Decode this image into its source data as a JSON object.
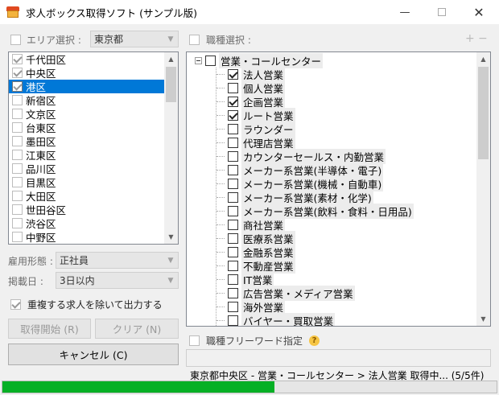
{
  "window": {
    "title": "求人ボックス取得ソフト (サンプル版)",
    "minimize": "—",
    "close": "✕"
  },
  "area": {
    "label": "エリア選択 :",
    "selected": "東京都",
    "items": [
      {
        "label": "千代田区",
        "checked": true,
        "selected": false
      },
      {
        "label": "中央区",
        "checked": true,
        "selected": false
      },
      {
        "label": "港区",
        "checked": true,
        "selected": true
      },
      {
        "label": "新宿区",
        "checked": false,
        "selected": false
      },
      {
        "label": "文京区",
        "checked": false,
        "selected": false
      },
      {
        "label": "台東区",
        "checked": false,
        "selected": false
      },
      {
        "label": "墨田区",
        "checked": false,
        "selected": false
      },
      {
        "label": "江東区",
        "checked": false,
        "selected": false
      },
      {
        "label": "品川区",
        "checked": false,
        "selected": false
      },
      {
        "label": "目黒区",
        "checked": false,
        "selected": false
      },
      {
        "label": "大田区",
        "checked": false,
        "selected": false
      },
      {
        "label": "世田谷区",
        "checked": false,
        "selected": false
      },
      {
        "label": "渋谷区",
        "checked": false,
        "selected": false
      },
      {
        "label": "中野区",
        "checked": false,
        "selected": false
      }
    ]
  },
  "employment": {
    "label": "雇用形態 :",
    "value": "正社員"
  },
  "posted": {
    "label": "掲載日 :",
    "value": "3日以内"
  },
  "dedupe": {
    "label": "重複する求人を除いて出力する",
    "checked": true
  },
  "buttons": {
    "start": "取得開始 (R)",
    "clear": "クリア (N)",
    "cancel": "キャンセル (C)"
  },
  "job": {
    "label": "職種選択 :",
    "plus": "+",
    "minus": "−",
    "root": "営業・コールセンター",
    "items": [
      {
        "label": "法人営業",
        "checked": true
      },
      {
        "label": "個人営業",
        "checked": false
      },
      {
        "label": "企画営業",
        "checked": true
      },
      {
        "label": "ルート営業",
        "checked": true
      },
      {
        "label": "ラウンダー",
        "checked": false
      },
      {
        "label": "代理店営業",
        "checked": false
      },
      {
        "label": "カウンターセールス・内勤営業",
        "checked": false
      },
      {
        "label": "メーカー系営業(半導体・電子)",
        "checked": false
      },
      {
        "label": "メーカー系営業(機械・自動車)",
        "checked": false
      },
      {
        "label": "メーカー系営業(素材・化学)",
        "checked": false
      },
      {
        "label": "メーカー系営業(飲料・食料・日用品)",
        "checked": false
      },
      {
        "label": "商社営業",
        "checked": false
      },
      {
        "label": "医療系営業",
        "checked": false
      },
      {
        "label": "金融系営業",
        "checked": false
      },
      {
        "label": "不動産営業",
        "checked": false
      },
      {
        "label": "IT営業",
        "checked": false
      },
      {
        "label": "広告営業・メディア営業",
        "checked": false
      },
      {
        "label": "海外営業",
        "checked": false
      },
      {
        "label": "バイヤー・買取営業",
        "checked": false
      }
    ]
  },
  "freeword": {
    "label": "職種フリーワード指定",
    "help": "?",
    "value": ""
  },
  "status": {
    "text": "東京都中央区 - 営業・コールセンター > 法人営業 取得中... (5/5件)"
  },
  "progress": {
    "percent": 55
  },
  "colors": {
    "accent": "#0078d7",
    "progress": "#06b025"
  }
}
